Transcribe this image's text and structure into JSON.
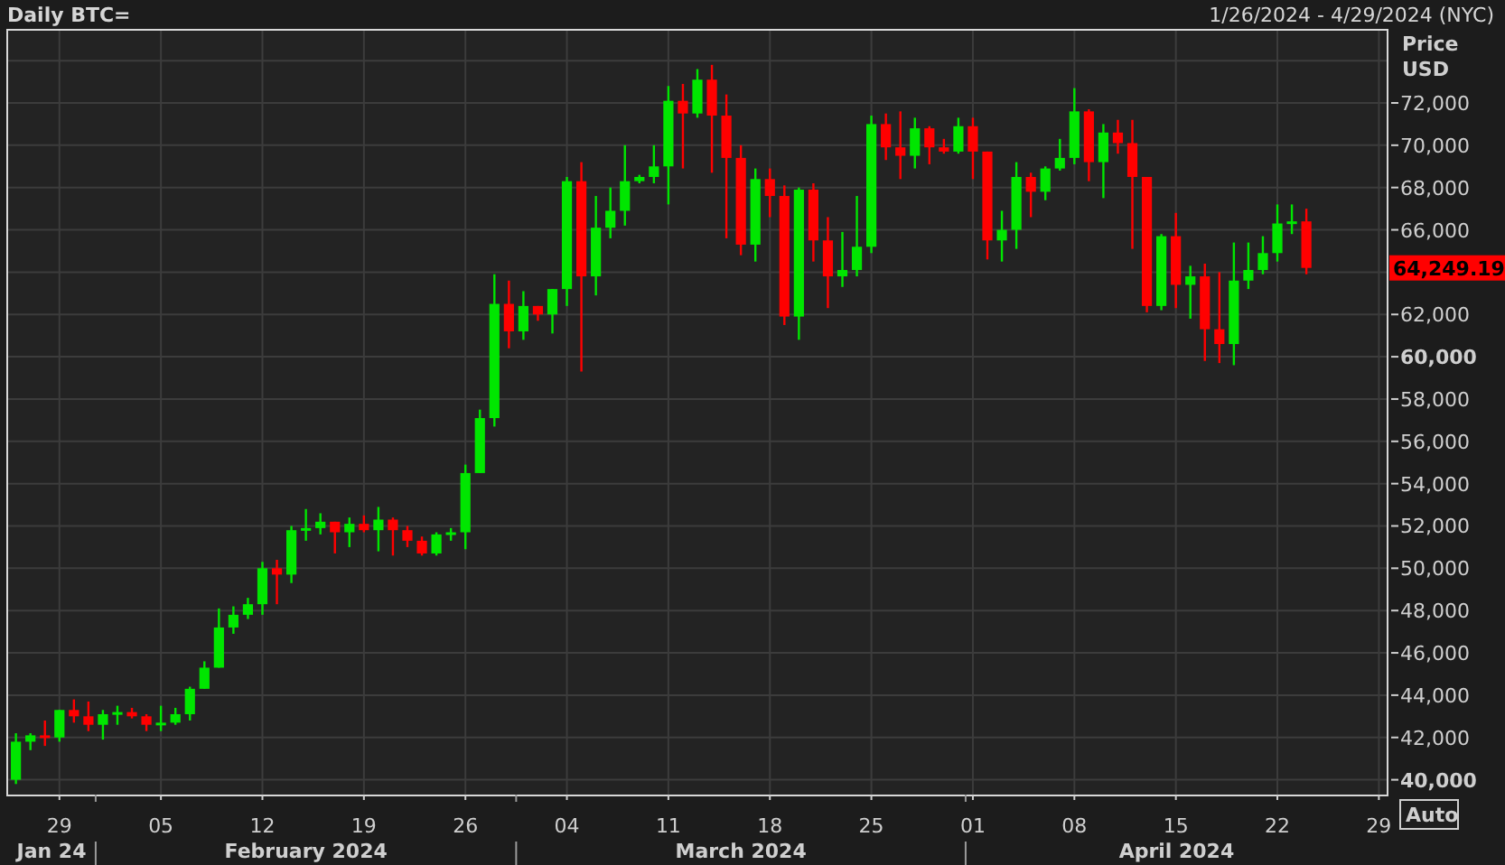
{
  "header": {
    "title": "Daily BTC=",
    "date_range": "1/26/2024 - 4/29/2024 (NYC)"
  },
  "axis": {
    "title_lines": [
      "Price",
      "USD"
    ],
    "last_price_label": "64,249.19",
    "auto_button": "Auto"
  },
  "months": [
    "Jan 24",
    "February 2024",
    "March 2024",
    "April 2024"
  ],
  "chart_data": {
    "type": "candlestick",
    "grid": true,
    "ylim": [
      39300,
      75500
    ],
    "categories": [
      null,
      null,
      null,
      "29",
      null,
      null,
      null,
      null,
      null,
      null,
      "05",
      null,
      null,
      null,
      null,
      null,
      null,
      "12",
      null,
      null,
      null,
      null,
      null,
      null,
      "19",
      null,
      null,
      null,
      null,
      null,
      null,
      "26",
      null,
      null,
      null,
      null,
      null,
      null,
      "04",
      null,
      null,
      null,
      null,
      null,
      null,
      "11",
      null,
      null,
      null,
      null,
      null,
      null,
      "18",
      null,
      null,
      null,
      null,
      null,
      null,
      "25",
      null,
      null,
      null,
      null,
      null,
      null,
      "01",
      null,
      null,
      null,
      null,
      null,
      null,
      "08",
      null,
      null,
      null,
      null,
      null,
      null,
      "15",
      null,
      null,
      null,
      null,
      null,
      null,
      "22",
      null,
      null,
      null,
      null,
      null,
      null,
      "29"
    ],
    "ohlc": [
      [
        40000,
        42200,
        39800,
        41800
      ],
      [
        41800,
        42200,
        41400,
        42100
      ],
      [
        42100,
        42800,
        41600,
        42000
      ],
      [
        42000,
        43300,
        41800,
        43300
      ],
      [
        43300,
        43800,
        42700,
        43000
      ],
      [
        43000,
        43700,
        42300,
        42600
      ],
      [
        42600,
        43300,
        41900,
        43100
      ],
      [
        43100,
        43500,
        42600,
        43200
      ],
      [
        43200,
        43400,
        42900,
        43000
      ],
      [
        43000,
        43100,
        42300,
        42600
      ],
      [
        42600,
        43500,
        42300,
        42700
      ],
      [
        42700,
        43400,
        42600,
        43100
      ],
      [
        43100,
        44400,
        42800,
        44300
      ],
      [
        44300,
        45600,
        44300,
        45300
      ],
      [
        45300,
        48100,
        45300,
        47200
      ],
      [
        47200,
        48200,
        46900,
        47800
      ],
      [
        47800,
        48600,
        47600,
        48300
      ],
      [
        48300,
        50300,
        47800,
        50000
      ],
      [
        50000,
        50400,
        48300,
        49700
      ],
      [
        49700,
        52000,
        49300,
        51800
      ],
      [
        51800,
        52800,
        51300,
        51900
      ],
      [
        51900,
        52600,
        51600,
        52200
      ],
      [
        52200,
        52200,
        50700,
        51700
      ],
      [
        51700,
        52400,
        51000,
        52100
      ],
      [
        52100,
        52500,
        51700,
        51800
      ],
      [
        51800,
        52900,
        50800,
        52300
      ],
      [
        52300,
        52400,
        50600,
        51800
      ],
      [
        51800,
        52000,
        51000,
        51300
      ],
      [
        51300,
        51500,
        50600,
        50700
      ],
      [
        50700,
        51700,
        50600,
        51600
      ],
      [
        51600,
        51900,
        51300,
        51700
      ],
      [
        51700,
        54900,
        50900,
        54500
      ],
      [
        54500,
        57500,
        54500,
        57100
      ],
      [
        57100,
        63900,
        56700,
        62500
      ],
      [
        62500,
        63600,
        60400,
        61200
      ],
      [
        61200,
        63100,
        60800,
        62400
      ],
      [
        62400,
        62400,
        61700,
        62000
      ],
      [
        62000,
        63200,
        61100,
        63200
      ],
      [
        63200,
        68500,
        62400,
        68300
      ],
      [
        68300,
        69200,
        59300,
        63800
      ],
      [
        63800,
        67600,
        62900,
        66100
      ],
      [
        66100,
        68000,
        65600,
        66900
      ],
      [
        66900,
        70000,
        66200,
        68300
      ],
      [
        68300,
        68600,
        68200,
        68500
      ],
      [
        68500,
        70000,
        68200,
        69000
      ],
      [
        69000,
        72800,
        67200,
        72100
      ],
      [
        72100,
        72900,
        68900,
        71500
      ],
      [
        71500,
        73600,
        71300,
        73100
      ],
      [
        73100,
        73800,
        68700,
        71400
      ],
      [
        71400,
        72400,
        65600,
        69400
      ],
      [
        69400,
        70000,
        64800,
        65300
      ],
      [
        65300,
        68900,
        64500,
        68400
      ],
      [
        68400,
        68900,
        66600,
        67600
      ],
      [
        67600,
        68100,
        61500,
        61900
      ],
      [
        61900,
        68000,
        60800,
        67900
      ],
      [
        67900,
        68200,
        64500,
        65500
      ],
      [
        65500,
        66600,
        62300,
        63800
      ],
      [
        63800,
        65900,
        63300,
        64100
      ],
      [
        64100,
        67600,
        63800,
        65200
      ],
      [
        65200,
        71400,
        64900,
        71000
      ],
      [
        71000,
        71500,
        69300,
        69900
      ],
      [
        69900,
        71600,
        68400,
        69500
      ],
      [
        69500,
        71300,
        68900,
        70800
      ],
      [
        70800,
        70900,
        69100,
        69900
      ],
      [
        69900,
        70300,
        69600,
        69700
      ],
      [
        69700,
        71300,
        69600,
        70900
      ],
      [
        70900,
        71300,
        68400,
        69700
      ],
      [
        69700,
        69700,
        64600,
        65500
      ],
      [
        65500,
        66900,
        64500,
        66000
      ],
      [
        66000,
        69200,
        65100,
        68500
      ],
      [
        68500,
        68700,
        66600,
        67800
      ],
      [
        67800,
        69000,
        67400,
        68900
      ],
      [
        68900,
        70300,
        68800,
        69400
      ],
      [
        69400,
        72700,
        69100,
        71600
      ],
      [
        71600,
        71700,
        68300,
        69200
      ],
      [
        69200,
        71000,
        67500,
        70600
      ],
      [
        70600,
        71200,
        69600,
        70100
      ],
      [
        70100,
        71200,
        65100,
        68500
      ],
      [
        68500,
        68500,
        62100,
        62400
      ],
      [
        62400,
        65800,
        62200,
        65700
      ],
      [
        65700,
        66800,
        62300,
        63400
      ],
      [
        63400,
        64300,
        61800,
        63800
      ],
      [
        63800,
        64400,
        59800,
        61300
      ],
      [
        61300,
        64000,
        59700,
        60600
      ],
      [
        60600,
        65400,
        59600,
        63600
      ],
      [
        63600,
        65400,
        63200,
        64100
      ],
      [
        64100,
        65700,
        63900,
        64900
      ],
      [
        64900,
        67200,
        64500,
        66300
      ],
      [
        66300,
        67200,
        65800,
        66400
      ],
      [
        66400,
        67000,
        63900,
        64200
      ],
      null,
      null,
      null,
      null,
      null
    ],
    "yticks": [
      {
        "value": 72000,
        "label": "72,000"
      },
      {
        "value": 70000,
        "label": "70,000"
      },
      {
        "value": 68000,
        "label": "68,000"
      },
      {
        "value": 66000,
        "label": "66,000"
      },
      {
        "value": 62000,
        "label": "62,000"
      },
      {
        "value": 60000,
        "label": "60,000"
      },
      {
        "value": 58000,
        "label": "58,000"
      },
      {
        "value": 56000,
        "label": "56,000"
      },
      {
        "value": 54000,
        "label": "54,000"
      },
      {
        "value": 52000,
        "label": "52,000"
      },
      {
        "value": 50000,
        "label": "50,000"
      },
      {
        "value": 48000,
        "label": "48,000"
      },
      {
        "value": 46000,
        "label": "46,000"
      },
      {
        "value": 44000,
        "label": "44,000"
      },
      {
        "value": 42000,
        "label": "42,000"
      },
      {
        "value": 40000,
        "label": "40,000"
      }
    ]
  }
}
